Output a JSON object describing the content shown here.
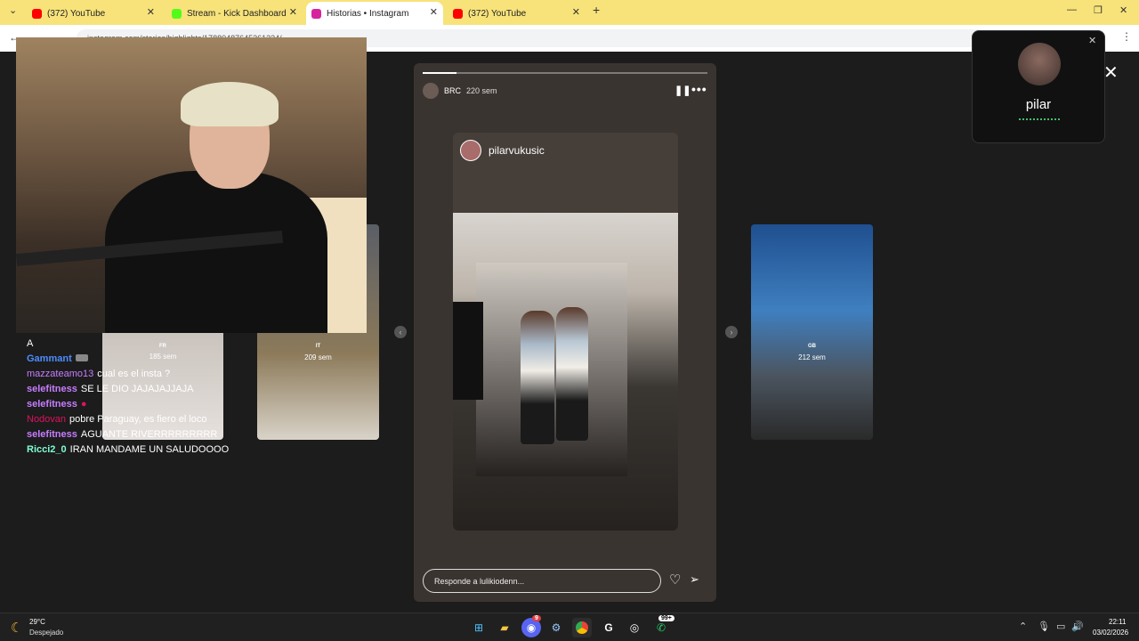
{
  "browser": {
    "tabs": [
      {
        "title": "(372) YouTube",
        "favicon_color": "#ff0000"
      },
      {
        "title": "Stream - Kick Dashboard",
        "favicon_color": "#53fc18"
      },
      {
        "title": "Historias • Instagram",
        "favicon_color": "#d6249f"
      },
      {
        "title": "(372) YouTube",
        "favicon_color": "#ff0000"
      }
    ],
    "new_tab": "+",
    "url": "instagram.com/stories/highlights/17880487645261334/"
  },
  "story": {
    "username": "BRC",
    "time": "220 sem",
    "repost_username": "pilarvukusic",
    "reply_placeholder": "Responde a lulikiodenn...",
    "progress": 0.12
  },
  "side_stories": [
    {
      "flag": "FR",
      "time": "185 sem"
    },
    {
      "flag": "IT",
      "time": "209 sem"
    },
    {
      "flag": "GB",
      "time": "212 sem"
    }
  ],
  "chat": [
    {
      "user": "A",
      "color": "#ffffff",
      "msg": ""
    },
    {
      "user": "Gammant",
      "color": "#4d8cff",
      "msg": ""
    },
    {
      "user": "mazzateamo13",
      "color": "#c77dff",
      "msg": "cual es el insta ?"
    },
    {
      "user": "selefitness",
      "color": "#c77dff",
      "msg": "SE LE DIO JAJAJAJJAJA"
    },
    {
      "user": "selefitness",
      "color": "#c77dff",
      "msg": ""
    },
    {
      "user": "Nodovan",
      "color": "#e0115f",
      "msg": "pobre Paraguay, es fiero el loco"
    },
    {
      "user": "selefitness",
      "color": "#c77dff",
      "msg": "AGUANTE RIVERRRRRRRRR"
    },
    {
      "user": "Ricci2_0",
      "color": "#7fffd4",
      "msg": "IRAN MANDAME UN SALUDOOOO"
    }
  ],
  "popup": {
    "name": "pilar"
  },
  "taskbar": {
    "temp": "29°C",
    "weather": "Despejado",
    "badge_discord": "9",
    "badge_whatsapp": "99+",
    "time": "22:11",
    "date": "03/02/2026"
  }
}
